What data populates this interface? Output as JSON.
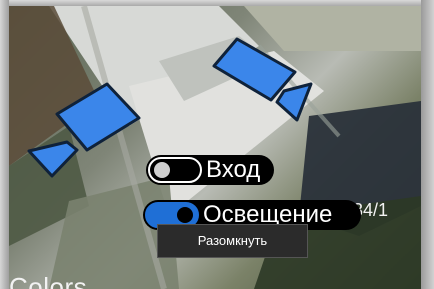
{
  "map": {
    "place_label": "Colors",
    "building_number": "34/1"
  },
  "overlay": {
    "toggles": [
      {
        "label": "Вход",
        "on": false
      },
      {
        "label": "Освещение",
        "on": true
      }
    ],
    "tooltip": "Разомкнуть"
  },
  "icons": {
    "camera_left": "camera-icon",
    "camera_right": "camera-icon"
  },
  "colors": {
    "toggle_on": "#1f6fd6",
    "camera_fill": "#3b86ea",
    "camera_stroke": "#0f223a"
  }
}
